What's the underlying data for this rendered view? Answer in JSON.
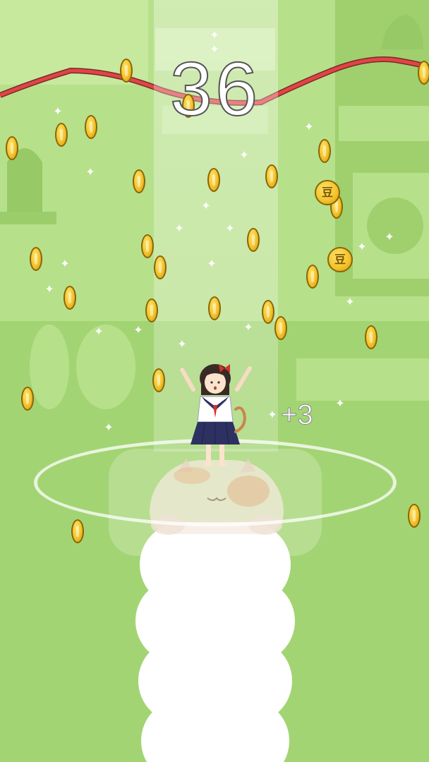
{
  "game": {
    "score": "36",
    "points_popup": "+3",
    "coin_emblem": "豆"
  },
  "colors": {
    "background": "#a9d97a",
    "background_shapes": "#9ccd6b",
    "rope": "#e04545",
    "coin": "#f3c22a",
    "cloud": "#ffffff"
  },
  "icons": {
    "coin": "gold-coin-icon",
    "sparkle": "sparkle-icon",
    "character": "schoolgirl-sprite",
    "platform": "cat-icon"
  }
}
